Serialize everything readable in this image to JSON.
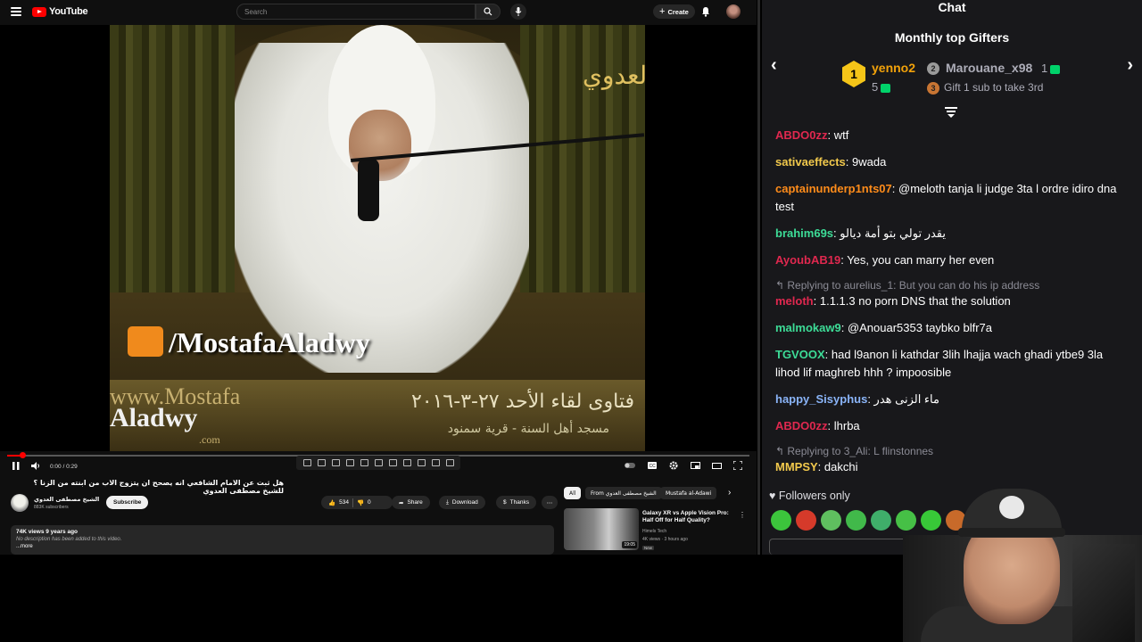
{
  "youtube": {
    "logo_text": "YouTube",
    "search_placeholder": "Search",
    "create_label": "Create",
    "player": {
      "time": "0:00 / 0:29",
      "progress_fraction": 0.02,
      "overlay_site": "/MostafaAladwy",
      "overlay_www": "www.Mostafa",
      "overlay_name": "Aladwy",
      "overlay_dotcom": ".com",
      "overlay_caption": "فتاوى لقاء الأحد ٢٧-٣-٢٠١٦",
      "overlay_subcaption": "مسجد أهل السنة - قرية سمنود",
      "corner_logo": "العدوي"
    },
    "video_title": "هل ثبت عن الامام الشافعي انه يصحح ان يتزوج الاب من ابنته من الزنا ؟ للشيخ مصطفى العدوي",
    "channel_name": "الشيخ مصطفى العدوي",
    "subscribers": "883K subscribers",
    "subscribe_label": "Subscribe",
    "likes": "534",
    "dislikes": "0",
    "share_label": "Share",
    "download_label": "Download",
    "thanks_label": "Thanks",
    "description": {
      "stats": "74K views  9 years ago",
      "text": "No description has been added to this video.",
      "more": "...more"
    },
    "chips": [
      "All",
      "From الشيخ مصطفى العدوي",
      "Mustafa al-Adawi"
    ],
    "recommendation": {
      "title": "Galaxy XR vs Apple Vision Pro: Half Off for Half Quality?",
      "channel": "Himels Tech",
      "views": "4K views · 3 hours ago",
      "badge": "New",
      "duration": "19:05"
    }
  },
  "chat": {
    "header": "Chat",
    "gifters_title": "Monthly top Gifters",
    "gifter1": {
      "rank": "1",
      "name": "yenno2",
      "count": "5"
    },
    "gifter2": {
      "rank": "2",
      "name": "Marouane_x98",
      "count": "1"
    },
    "gifter3": {
      "rank": "3",
      "text": "Gift 1 sub to take 3rd"
    },
    "messages": [
      {
        "user": "ABDO0zz",
        "color": "#e0284f",
        "text": "wtf"
      },
      {
        "user": "sativaeffects",
        "color": "#f2c94c",
        "text": "9wada"
      },
      {
        "user": "captainunderp1nts07",
        "color": "#ff8c1a",
        "text": "@meloth tanja li judge 3ta l ordre idiro dna test"
      },
      {
        "user": "brahim69s",
        "color": "#3ddc97",
        "text": "يقدر تولي بتو أمة ديالو"
      },
      {
        "user": "AyoubAB19",
        "color": "#e0284f",
        "text": "Yes, you can marry her even"
      },
      {
        "reply": "Replying to aurelius_1: But you can do his ip address"
      },
      {
        "user": "meloth",
        "color": "#e0284f",
        "text": "1.1.1.3 no porn DNS that the solution"
      },
      {
        "user": "malmokaw9",
        "color": "#3ddc97",
        "text": "@Anouar5353 taybko blfr7a"
      },
      {
        "user": "TGVOOX",
        "color": "#3ddc97",
        "text": "had l9anon li kathdar 3lih lhajja wach ghadi ytbe9 3la lihod lif maghreb hhh ? impoosible"
      },
      {
        "user": "happy_Sisyphus",
        "color": "#8ab4f8",
        "text": "ماء الزنى هدر"
      },
      {
        "user": "ABDO0zz",
        "color": "#e0284f",
        "text": "lhrba"
      },
      {
        "reply": "Replying to 3_Ali: L flinstonnes"
      },
      {
        "user": "MMPSY",
        "color": "#f2c94c",
        "text": "dakchi"
      }
    ],
    "followers_only": "Followers only"
  }
}
